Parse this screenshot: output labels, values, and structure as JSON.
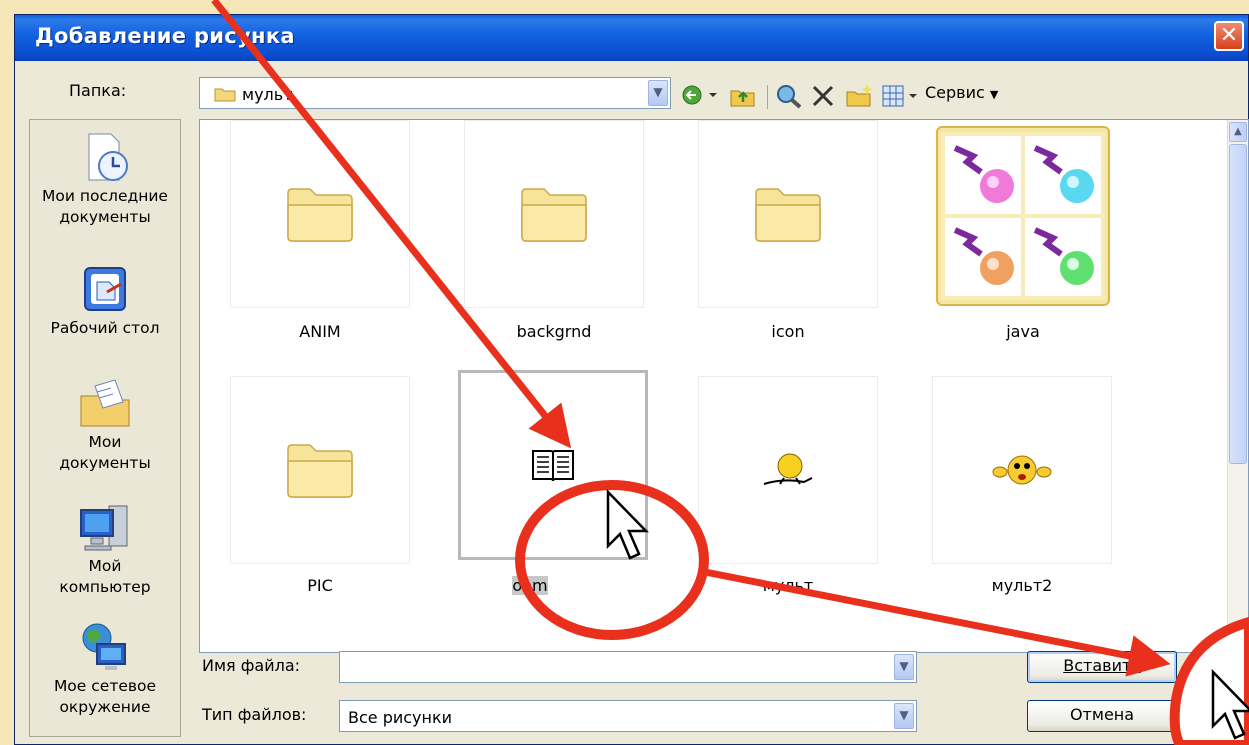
{
  "window": {
    "title": "Добавление рисунка",
    "close_glyph": "✕"
  },
  "toolbar": {
    "folder_label": "Папка:",
    "folder_value": "мульт",
    "service_label": "Сервис",
    "icons": [
      "back-icon",
      "up-folder-icon",
      "search-web-icon",
      "delete-icon",
      "new-folder-icon",
      "views-icon"
    ]
  },
  "places": [
    {
      "label_lines": [
        "Мои последние",
        "документы"
      ],
      "icon": "recent-documents-icon"
    },
    {
      "label_lines": [
        "Рабочий стол"
      ],
      "icon": "desktop-icon"
    },
    {
      "label_lines": [
        "Мои",
        "документы"
      ],
      "icon": "my-documents-icon"
    },
    {
      "label_lines": [
        "Мой",
        "компьютер"
      ],
      "icon": "my-computer-icon"
    },
    {
      "label_lines": [
        "Мое сетевое",
        "окружение"
      ],
      "icon": "network-places-icon"
    }
  ],
  "files": [
    {
      "name": "ANIM",
      "kind": "folder"
    },
    {
      "name": "backgrnd",
      "kind": "folder"
    },
    {
      "name": "icon",
      "kind": "folder"
    },
    {
      "name": "java",
      "kind": "image"
    },
    {
      "name": "PIC",
      "kind": "folder"
    },
    {
      "name": "book",
      "kind": "image",
      "visible_label": "oom",
      "selected": true
    },
    {
      "name": "мульт",
      "kind": "image"
    },
    {
      "name": "мульт2",
      "kind": "image"
    }
  ],
  "form": {
    "filename_label": "Имя файла:",
    "filename_value": "",
    "filetype_label": "Тип файлов:",
    "filetype_value": "Все рисунки"
  },
  "buttons": {
    "insert_label": "Вставить",
    "cancel_label": "Отмена"
  },
  "colors": {
    "titlebar": "#0b4fd0",
    "dialog_bg": "#ece9d8",
    "annotation_red": "#e8301c",
    "slide_bg": "#f6e6b8"
  }
}
